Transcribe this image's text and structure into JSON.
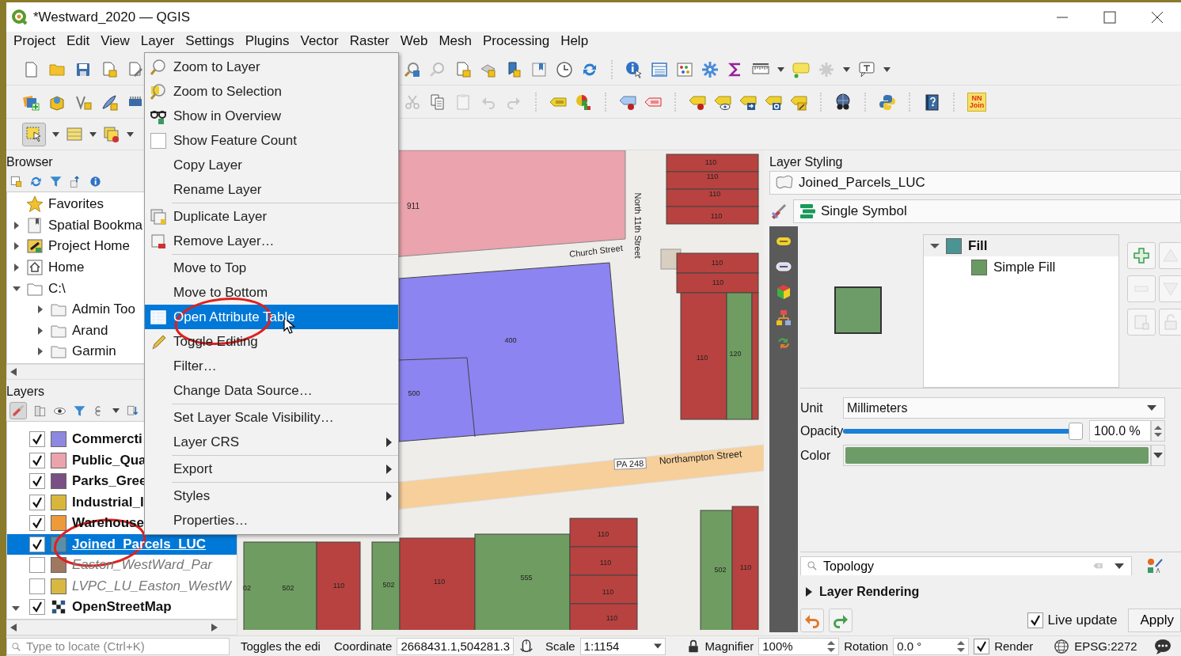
{
  "window": {
    "title": "*Westward_2020 — QGIS"
  },
  "menu_bar": [
    "Project",
    "Edit",
    "View",
    "Layer",
    "Settings",
    "Plugins",
    "Vector",
    "Raster",
    "Web",
    "Mesh",
    "Processing",
    "Help"
  ],
  "toolbar": {
    "plugin_button": "NN Join"
  },
  "browser": {
    "title": "Browser",
    "items": [
      {
        "label": "Favorites",
        "kind": "favorites"
      },
      {
        "label": "Spatial Bookma",
        "kind": "bookmarks",
        "expanded": false
      },
      {
        "label": "Project Home",
        "kind": "project",
        "expanded": false
      },
      {
        "label": "Home",
        "kind": "home",
        "expanded": false
      },
      {
        "label": "C:\\",
        "kind": "drive",
        "expanded": true,
        "children": [
          {
            "label": "Admin Too",
            "kind": "folder",
            "expanded": false
          },
          {
            "label": "Arand",
            "kind": "folder",
            "expanded": false
          },
          {
            "label": "Garmin",
            "kind": "folder",
            "expanded": false
          }
        ]
      }
    ]
  },
  "layers": {
    "title": "Layers",
    "items": [
      {
        "name": "Commercti",
        "kind": "vector",
        "checked": true,
        "selected": false,
        "color": "#8f88e0"
      },
      {
        "name": "Public_Qua",
        "kind": "vector",
        "checked": true,
        "selected": false,
        "color": "#eba3ad"
      },
      {
        "name": "Parks_Gree",
        "kind": "vector",
        "checked": true,
        "selected": false,
        "color": "#7a4f85"
      },
      {
        "name": "Industrial_I",
        "kind": "vector",
        "checked": true,
        "selected": false,
        "color": "#d8b63c"
      },
      {
        "name": "Warehouse",
        "kind": "vector",
        "checked": true,
        "selected": false,
        "color": "#ee9a3a"
      },
      {
        "name": "Joined_Parcels_LUC",
        "kind": "vector",
        "checked": true,
        "selected": true,
        "color": "#5a8fa8"
      },
      {
        "name": "Easton_WestWard_Par",
        "kind": "vector",
        "checked": false,
        "selected": false,
        "color": "#a07860"
      },
      {
        "name": "LVPC_LU_Easton_WestW",
        "kind": "vector",
        "checked": false,
        "selected": false,
        "color": "#d8b840"
      },
      {
        "name": "OpenStreetMap",
        "kind": "raster",
        "checked": true,
        "selected": false,
        "expanded": true
      }
    ]
  },
  "context_menu": [
    {
      "label": "Zoom to Layer",
      "kind": "action",
      "selected": false
    },
    {
      "label": "Zoom to Selection",
      "kind": "action",
      "selected": false
    },
    {
      "label": "Show in Overview",
      "kind": "action",
      "selected": false
    },
    {
      "label": "Show Feature Count",
      "kind": "check",
      "checked": false,
      "selected": false
    },
    {
      "label": "Copy Layer",
      "kind": "action",
      "selected": false
    },
    {
      "label": "Rename Layer",
      "kind": "action",
      "selected": false
    },
    {
      "kind": "separator"
    },
    {
      "label": "Duplicate Layer",
      "kind": "action",
      "selected": false
    },
    {
      "label": "Remove Layer…",
      "kind": "action",
      "selected": false
    },
    {
      "kind": "separator"
    },
    {
      "label": "Move to Top",
      "kind": "action",
      "selected": false
    },
    {
      "label": "Move to Bottom",
      "kind": "action",
      "selected": false
    },
    {
      "label": "Open Attribute Table",
      "kind": "action",
      "selected": true
    },
    {
      "label": "Toggle Editing",
      "kind": "action",
      "selected": false
    },
    {
      "label": "Filter…",
      "kind": "action",
      "selected": false
    },
    {
      "label": "Change Data Source…",
      "kind": "action",
      "selected": false
    },
    {
      "kind": "separator"
    },
    {
      "label": "Set Layer Scale Visibility…",
      "kind": "action",
      "selected": false
    },
    {
      "label": "Layer CRS",
      "kind": "submenu",
      "selected": false
    },
    {
      "kind": "separator"
    },
    {
      "label": "Export",
      "kind": "submenu",
      "selected": false
    },
    {
      "kind": "separator"
    },
    {
      "label": "Styles",
      "kind": "submenu",
      "selected": false
    },
    {
      "label": "Properties…",
      "kind": "action",
      "selected": false
    }
  ],
  "map": {
    "labels": [
      "911",
      "110",
      "110",
      "110",
      "110",
      "Church Street",
      "North 11th Street",
      "110",
      "110",
      "400",
      "500",
      "110",
      "120",
      "PA 248",
      "Northampton Street",
      "110",
      "110",
      "110",
      "110",
      "555",
      "502",
      "110",
      "502",
      "110",
      "02",
      "502",
      "110"
    ]
  },
  "layer_styling": {
    "title": "Layer Styling",
    "layer": "Joined_Parcels_LUC",
    "renderer": "Single Symbol",
    "symbol_tree": [
      {
        "label": "Fill",
        "kind": "symbol",
        "expanded": true,
        "selected": true,
        "color": "#4b9494"
      },
      {
        "label": "Simple Fill",
        "kind": "layer",
        "selected": false,
        "color": "#6a9a62"
      }
    ],
    "unit_label": "Unit",
    "unit": "Millimeters",
    "opacity_label": "Opacity",
    "opacity": {
      "level": 1.0,
      "reading": "100.0 %"
    },
    "color_label": "Color",
    "search": {
      "value": "Topology"
    },
    "section": {
      "label": "Layer Rendering",
      "expanded": false
    },
    "live_update": {
      "label": "Live update",
      "checked": true
    },
    "apply": "Apply"
  },
  "status_bar": {
    "locator_placeholder": "Type to locate (Ctrl+K)",
    "message": "Toggles the edi",
    "coordinate_label": "Coordinate",
    "coordinate": "2668431.1,504281.3",
    "scale_label": "Scale",
    "scale": "1:1154",
    "magnifier_label": "Magnifier",
    "magnifier": "100%",
    "rotation_label": "Rotation",
    "rotation": "0.0 °",
    "render": {
      "label": "Render",
      "checked": true
    },
    "crs": "EPSG:2272"
  }
}
